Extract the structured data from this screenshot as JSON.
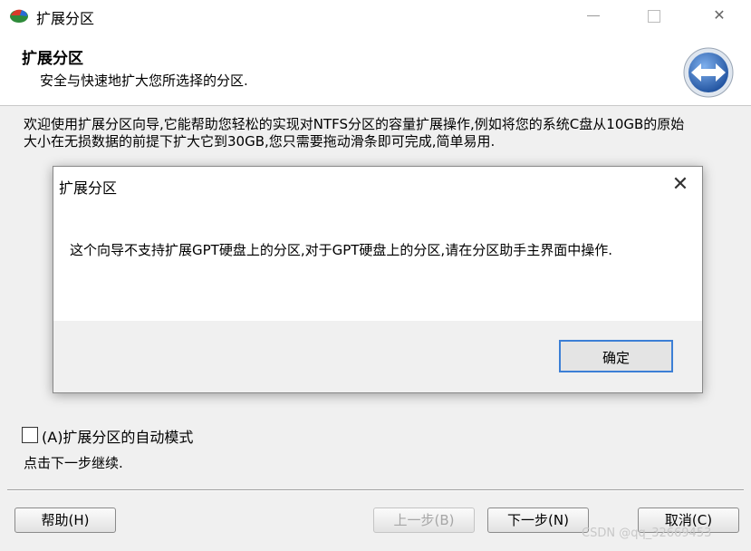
{
  "window": {
    "title": "扩展分区",
    "minimize_glyph": "─",
    "close_glyph": "✕"
  },
  "header": {
    "title": "扩展分区",
    "subtitle": "安全与快速地扩大您所选择的分区.",
    "icon": "double-arrow-icon"
  },
  "main": {
    "intro": "欢迎使用扩展分区向导,它能帮助您轻松的实现对NTFS分区的容量扩展操作,例如将您的系统C盘从10GB的原始大小在无损数据的前提下扩大它到30GB,您只需要拖动滑条即可完成,简单易用.",
    "auto_mode_label": "(A)扩展分区的自动模式",
    "auto_mode_checked": false,
    "hint": "点击下一步继续."
  },
  "buttons": {
    "help": "帮助(H)",
    "prev": "上一步(B)",
    "next": "下一步(N)",
    "cancel": "取消(C)"
  },
  "dialog": {
    "title": "扩展分区",
    "close_glyph": "✕",
    "message": "这个向导不支持扩展GPT硬盘上的分区,对于GPT硬盘上的分区,请在分区助手主界面中操作.",
    "ok": "确定"
  },
  "watermark": "CSDN @qq_32669453",
  "colors": {
    "accent_blue": "#3c7fd6",
    "window_bg": "#f0f0f0"
  }
}
